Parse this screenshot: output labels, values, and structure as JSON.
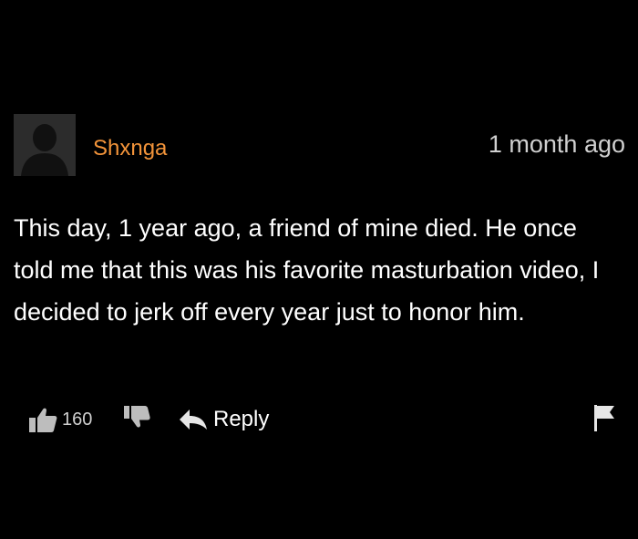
{
  "comment": {
    "username": "Shxnga",
    "timestamp": "1 month ago",
    "text": "This day, 1 year ago, a friend of mine died. He once told me that this was his favorite masturbation video, I decided to jerk off every year just to honor him.",
    "avatar_icon": "default-user-silhouette-icon",
    "colors": {
      "background": "#000000",
      "username": "#f3943a",
      "text": "#ffffff",
      "muted": "#cfcfcf"
    }
  },
  "actions": {
    "like_icon": "thumbs-up-icon",
    "like_count": "160",
    "dislike_icon": "thumbs-down-icon",
    "reply_icon": "reply-arrow-icon",
    "reply_label": "Reply",
    "flag_icon": "flag-icon"
  }
}
